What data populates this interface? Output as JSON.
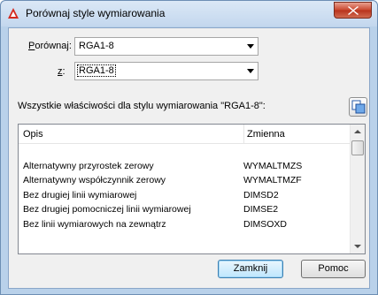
{
  "window": {
    "title": "Porównaj style wymiarowania"
  },
  "compare": {
    "porownaj_label": "Porównaj:",
    "porownaj_value": "RGA1-8",
    "z_label": "z:",
    "z_value": "RGA1-8"
  },
  "section": {
    "text": "Wszystkie właściwości dla stylu wymiarowania \"RGA1-8\":"
  },
  "table": {
    "headers": {
      "desc": "Opis",
      "var": "Zmienna"
    },
    "rows": [
      {
        "desc": "",
        "var": ""
      },
      {
        "desc": "Alternatywny przyrostek zerowy",
        "var": "WYMALTMZS"
      },
      {
        "desc": "Alternatywny współczynnik zerowy",
        "var": "WYMALTMZF"
      },
      {
        "desc": "Bez drugiej linii wymiarowej",
        "var": "DIMSD2"
      },
      {
        "desc": "Bez drugiej pomocniczej linii wymiarowej",
        "var": "DIMSE2"
      },
      {
        "desc": "Bez linii wymiarowych na zewnątrz",
        "var": "DIMSOXD"
      }
    ]
  },
  "buttons": {
    "close": "Zamknij",
    "help": "Pomoc"
  },
  "colors": {
    "titlebar": "#c3d7ee",
    "close_red": "#c9462c",
    "default_button": "#bee6fd"
  }
}
